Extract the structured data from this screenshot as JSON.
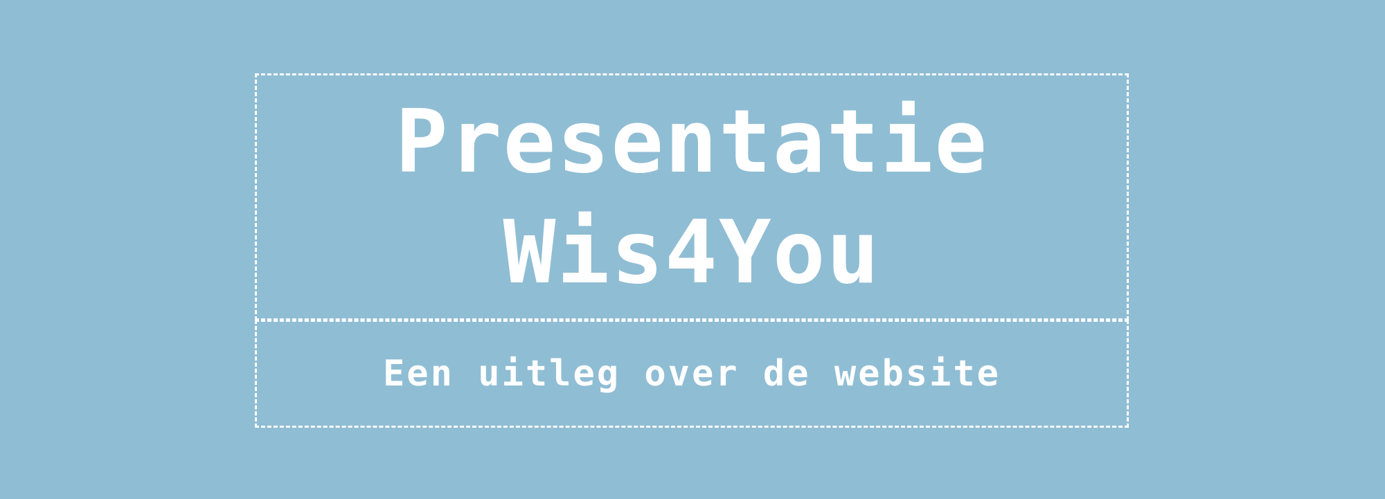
{
  "slide": {
    "title_line1": "Presentatie",
    "title_line2": "Wis4You",
    "subtitle": "Een uitleg over de website"
  },
  "colors": {
    "background": "#8fbdd4",
    "text": "#ffffff",
    "border": "#ffffff"
  }
}
